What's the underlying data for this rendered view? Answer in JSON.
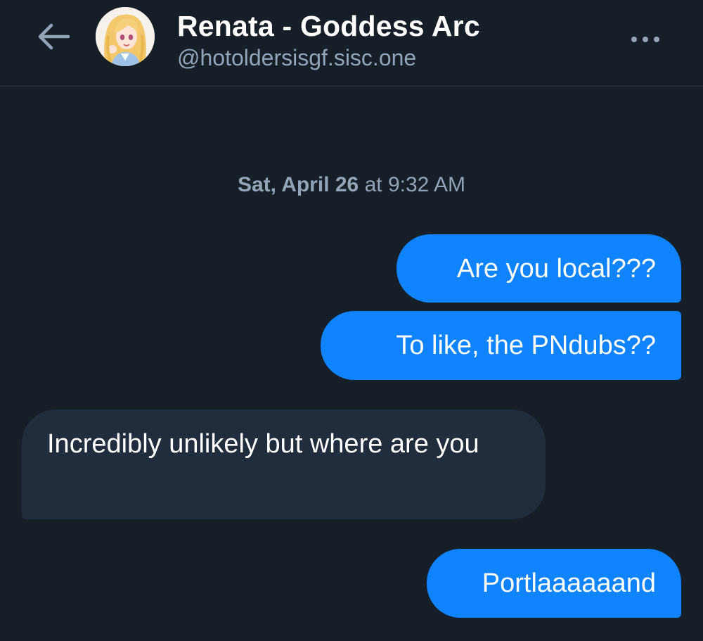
{
  "header": {
    "title": "Renata - Goddess Arc",
    "handle": "@hotoldersisgf.sisc.one",
    "back_icon": "arrow-left-icon",
    "more_icon": "ellipsis-icon"
  },
  "conversation": {
    "date_separator": {
      "day": "Sat, April 26",
      "connector": "at",
      "time": "9:32 AM"
    },
    "messages": [
      {
        "direction": "sent",
        "text": "Are you local???"
      },
      {
        "direction": "sent",
        "text": "To like, the PNdubs??"
      },
      {
        "direction": "received",
        "text": "Incredibly unlikely but where are you"
      },
      {
        "direction": "sent",
        "text": "Portlaaaaaand"
      }
    ]
  },
  "colors": {
    "background": "#161e27",
    "sent_bubble": "#1083fe",
    "received_bubble": "#212d3d",
    "muted_text": "#93a3b8"
  }
}
